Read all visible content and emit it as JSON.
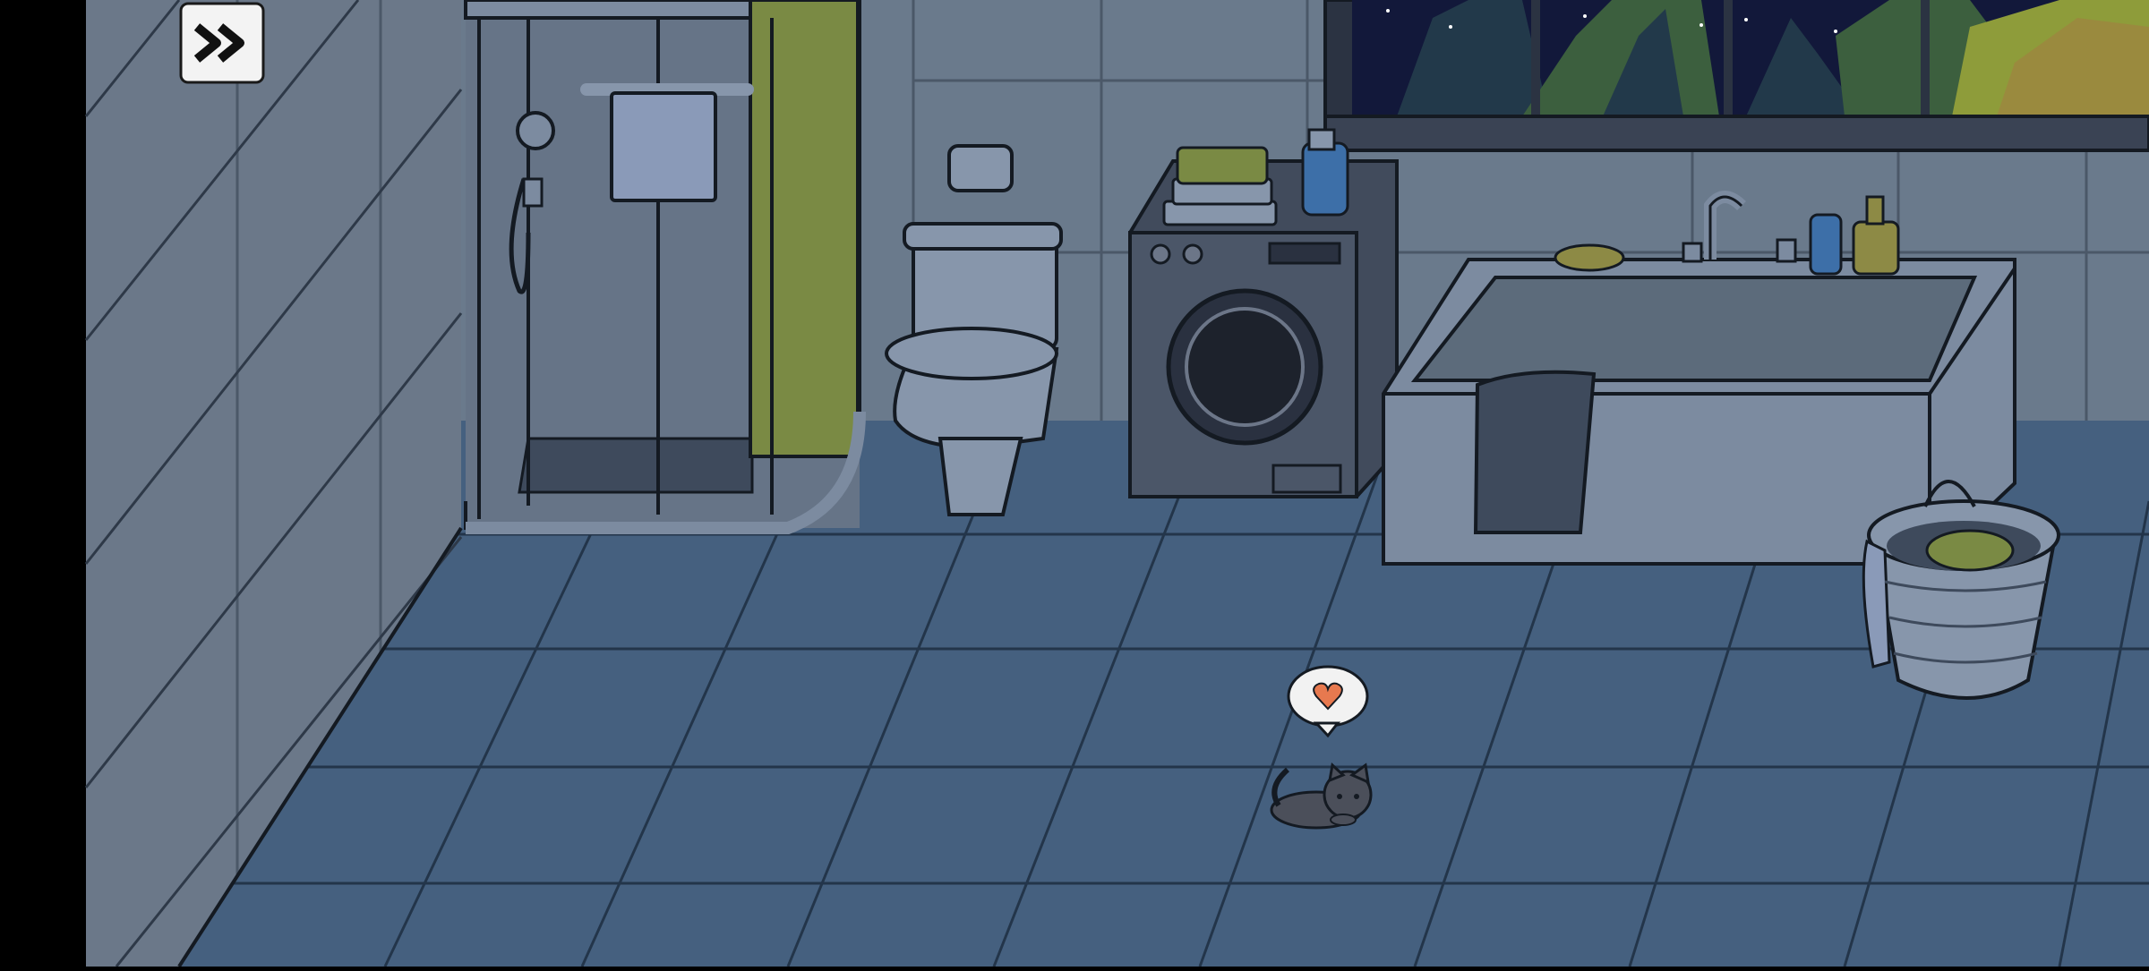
{
  "scene": {
    "name": "bathroom-night",
    "colors": {
      "frame": "#000000",
      "wall_left": "#6b7889",
      "wall_back": "#6a7a8c",
      "grout": "#4b5868",
      "floor": "#45607f",
      "floor_lines": "#23354a",
      "outline": "#141a22",
      "fixture": "#7c8ba0",
      "fixture_light": "#8796ab",
      "tub_inside": "#5c6b7b",
      "curtain": "#7a8a44",
      "towel": "#8a9ab8",
      "dark_towel": "#3e4a5c",
      "machine": "#414b5c",
      "sky": "#12183a",
      "tree_dark": "#22394a",
      "tree_green": "#3c5f3e",
      "tree_light": "#8e9c3a",
      "bottle_blue": "#3d6fa8",
      "bottle_yellow": "#8d8a45",
      "heart": "#e7794f",
      "bubble": "#f2f2f2",
      "cat": "#4b4f5a"
    }
  },
  "controls": {
    "skip": {
      "icon": "fast-forward-icon"
    }
  },
  "cat": {
    "emote": "heart-icon"
  }
}
